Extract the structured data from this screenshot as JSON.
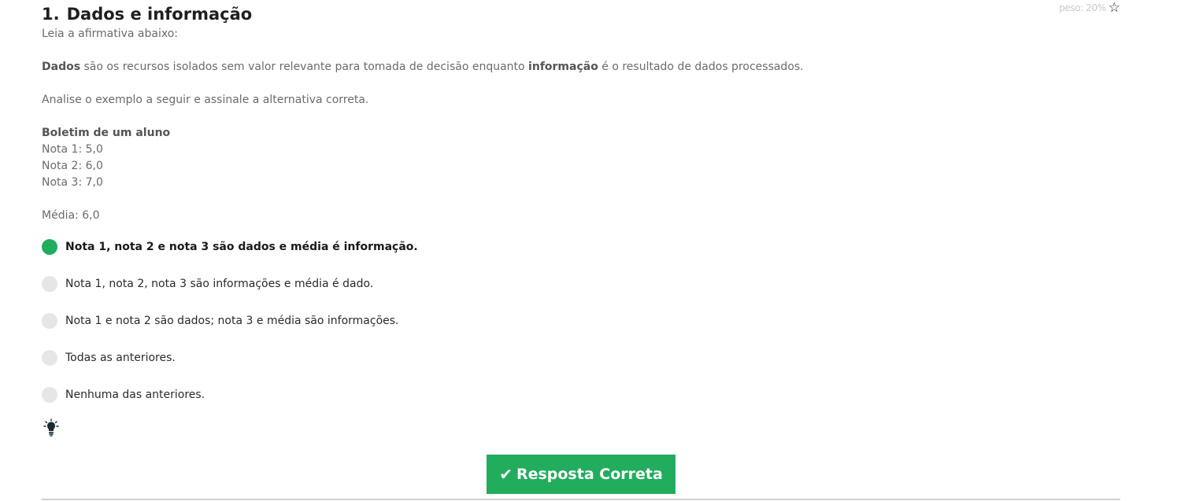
{
  "question": {
    "number": "1.",
    "title": "Dados e informação",
    "weight": "peso: 20%",
    "intro": "Leia a afirmativa abaixo:",
    "statement": {
      "term1": "Dados",
      "middle": " são os recursos isolados sem valor relevante para tomada de decisão enquanto ",
      "term2": "informação",
      "end": " é o resultado de dados processados."
    },
    "instruction": "Analise o exemplo a seguir e assinale a alternativa correta.",
    "example": {
      "heading": "Boletim de um aluno",
      "lines": [
        "Nota 1: 5,0",
        "Nota 2: 6,0",
        "Nota 3: 7,0"
      ],
      "average": "Média: 6,0"
    },
    "options": [
      {
        "label": "Nota 1, nota 2 e nota 3 são dados e média é informação.",
        "selected": true
      },
      {
        "label": "Nota 1, nota 2, nota 3 são informações e média é dado.",
        "selected": false
      },
      {
        "label": "Nota 1 e nota 2 são dados; nota 3 e média são informações.",
        "selected": false
      },
      {
        "label": "Todas as anteriores.",
        "selected": false
      },
      {
        "label": "Nenhuma das anteriores.",
        "selected": false
      }
    ],
    "hint_icon": "lightbulb-icon",
    "result_button": {
      "label": "Resposta Correta",
      "icon": "checkmark-icon"
    }
  },
  "colors": {
    "accent_green": "#22ac5e",
    "radio_unselected": "#e4e6e7"
  }
}
